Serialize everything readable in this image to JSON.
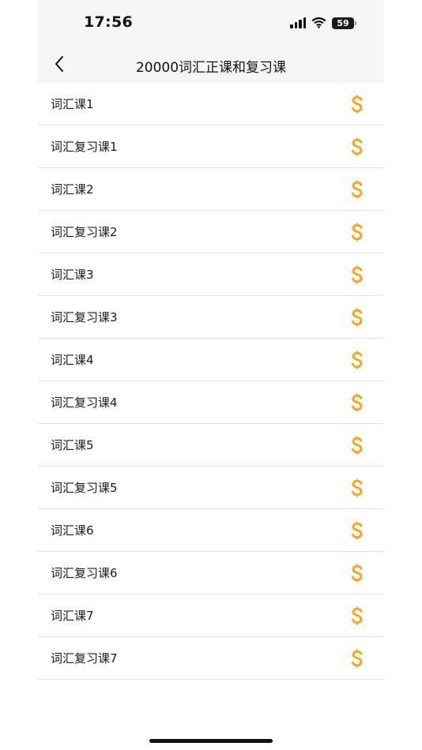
{
  "status_bar": {
    "time": "17:56",
    "battery": "59",
    "icons": [
      "signal-icon",
      "wifi-icon",
      "battery-icon"
    ]
  },
  "nav": {
    "back_icon": "chevron-left-icon",
    "title": "20000词汇正课和复习课"
  },
  "items": [
    {
      "label": "词汇课1",
      "icon": "dollar-icon"
    },
    {
      "label": "词汇复习课1",
      "icon": "dollar-icon"
    },
    {
      "label": "词汇课2",
      "icon": "dollar-icon"
    },
    {
      "label": "词汇复习课2",
      "icon": "dollar-icon"
    },
    {
      "label": "词汇课3",
      "icon": "dollar-icon"
    },
    {
      "label": "词汇复习课3",
      "icon": "dollar-icon"
    },
    {
      "label": "词汇课4",
      "icon": "dollar-icon"
    },
    {
      "label": "词汇复习课4",
      "icon": "dollar-icon"
    },
    {
      "label": "词汇课5",
      "icon": "dollar-icon"
    },
    {
      "label": "词汇复习课5",
      "icon": "dollar-icon"
    },
    {
      "label": "词汇课6",
      "icon": "dollar-icon"
    },
    {
      "label": "词汇复习课6",
      "icon": "dollar-icon"
    },
    {
      "label": "词汇课7",
      "icon": "dollar-icon"
    },
    {
      "label": "词汇复习课7",
      "icon": "dollar-icon"
    }
  ],
  "colors": {
    "accent": "#f5a623",
    "background": "#ffffff",
    "header_background": "#f6f6f6",
    "divider": "#e3e3e3"
  }
}
